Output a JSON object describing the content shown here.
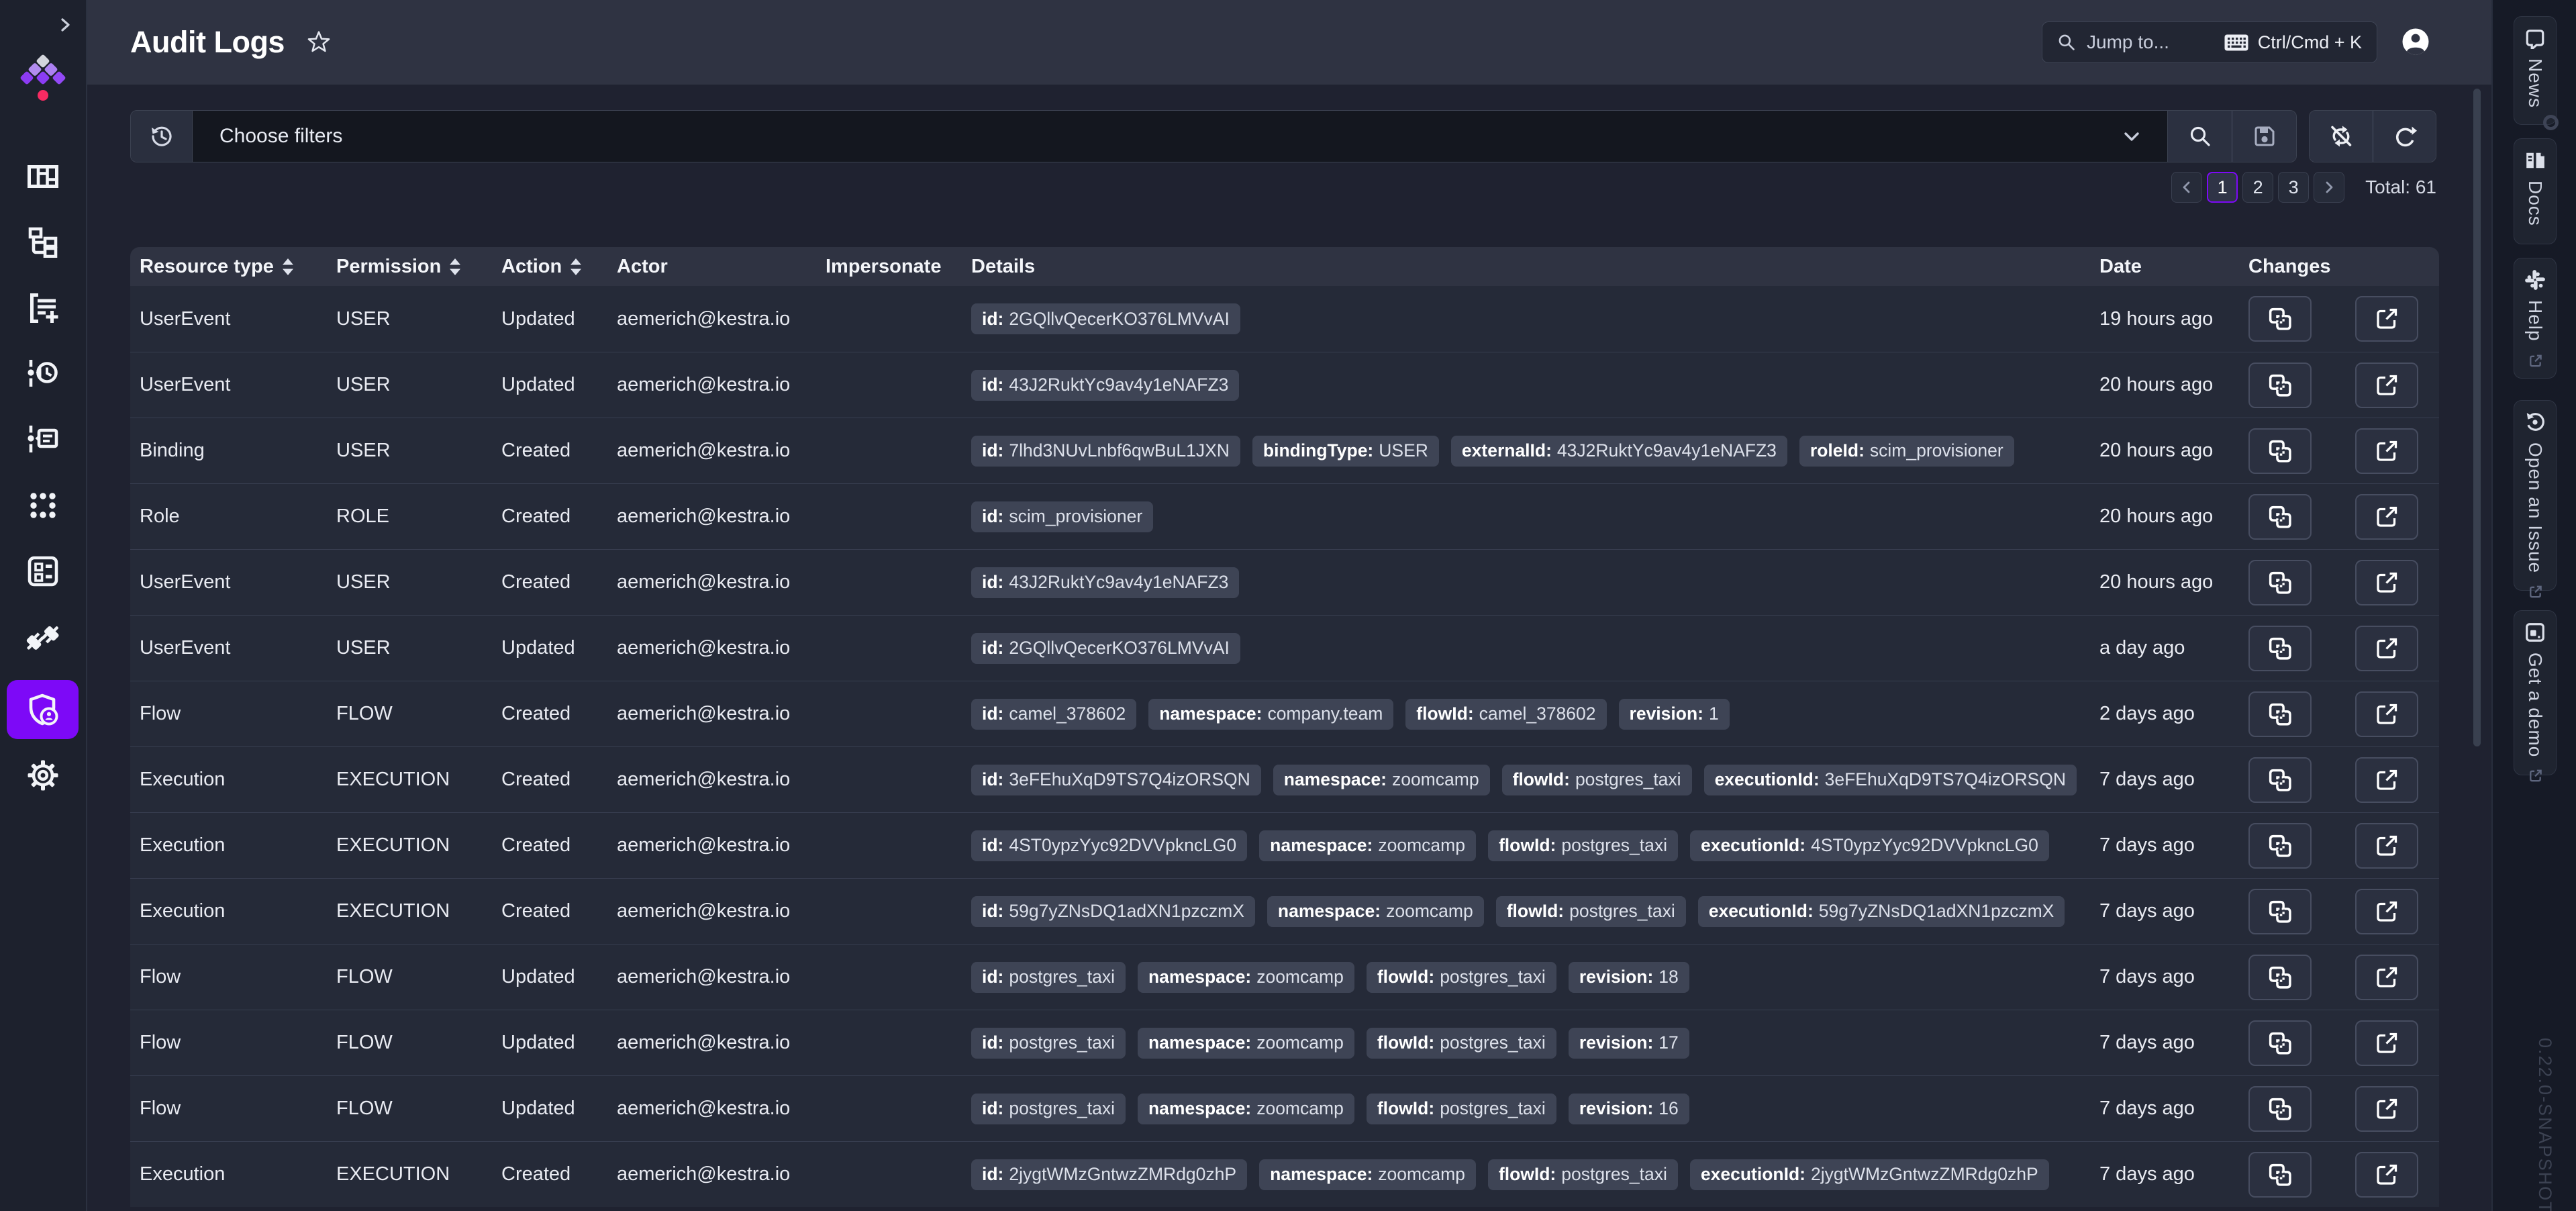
{
  "app": {
    "title": "Audit Logs"
  },
  "topbar": {
    "search_placeholder": "Jump to...",
    "shortcut": "Ctrl/Cmd + K"
  },
  "left_sidebar": {
    "items": [
      {
        "name": "dashboard",
        "icon": "dashboard-icon",
        "active": false
      },
      {
        "name": "flows",
        "icon": "flows-icon",
        "active": false
      },
      {
        "name": "executions",
        "icon": "executions-icon",
        "active": false
      },
      {
        "name": "logs",
        "icon": "logs-icon",
        "active": false
      },
      {
        "name": "namespaces",
        "icon": "namespaces-icon",
        "active": false
      },
      {
        "name": "apps",
        "icon": "apps-icon",
        "active": false
      },
      {
        "name": "blueprints",
        "icon": "blueprints-icon",
        "active": false
      },
      {
        "name": "plugins",
        "icon": "plugins-icon",
        "active": false
      },
      {
        "name": "iam-audit-logs",
        "icon": "shield-account-icon",
        "active": true
      },
      {
        "name": "settings",
        "icon": "gear-icon",
        "active": false
      }
    ],
    "active_color": "#7D09F7"
  },
  "filter": {
    "placeholder": "Choose filters"
  },
  "pagination": {
    "pages": [
      "1",
      "2",
      "3"
    ],
    "current": "1",
    "total_label": "Total: 61"
  },
  "table": {
    "columns": [
      {
        "label": "Resource type",
        "sortable": true
      },
      {
        "label": "Permission",
        "sortable": true
      },
      {
        "label": "Action",
        "sortable": true
      },
      {
        "label": "Actor",
        "sortable": false
      },
      {
        "label": "Impersonate",
        "sortable": false
      },
      {
        "label": "Details",
        "sortable": false
      },
      {
        "label": "Date",
        "sortable": false
      },
      {
        "label": "Changes",
        "sortable": false
      }
    ],
    "rows": [
      {
        "resource_type": "UserEvent",
        "permission": "USER",
        "action": "Updated",
        "actor": "aemerich@kestra.io",
        "impersonate": "",
        "details": [
          {
            "key": "id",
            "value": "2GQllvQecerKO376LMVvAI"
          }
        ],
        "date": "19 hours ago"
      },
      {
        "resource_type": "UserEvent",
        "permission": "USER",
        "action": "Updated",
        "actor": "aemerich@kestra.io",
        "impersonate": "",
        "details": [
          {
            "key": "id",
            "value": "43J2RuktYc9av4y1eNAFZ3"
          }
        ],
        "date": "20 hours ago"
      },
      {
        "resource_type": "Binding",
        "permission": "USER",
        "action": "Created",
        "actor": "aemerich@kestra.io",
        "impersonate": "",
        "details": [
          {
            "key": "id",
            "value": "7lhd3NUvLnbf6qwBuL1JXN"
          },
          {
            "key": "bindingType",
            "value": "USER"
          },
          {
            "key": "externalId",
            "value": "43J2RuktYc9av4y1eNAFZ3"
          },
          {
            "key": "roleId",
            "value": "scim_provisioner"
          }
        ],
        "date": "20 hours ago"
      },
      {
        "resource_type": "Role",
        "permission": "ROLE",
        "action": "Created",
        "actor": "aemerich@kestra.io",
        "impersonate": "",
        "details": [
          {
            "key": "id",
            "value": "scim_provisioner"
          }
        ],
        "date": "20 hours ago"
      },
      {
        "resource_type": "UserEvent",
        "permission": "USER",
        "action": "Created",
        "actor": "aemerich@kestra.io",
        "impersonate": "",
        "details": [
          {
            "key": "id",
            "value": "43J2RuktYc9av4y1eNAFZ3"
          }
        ],
        "date": "20 hours ago"
      },
      {
        "resource_type": "UserEvent",
        "permission": "USER",
        "action": "Updated",
        "actor": "aemerich@kestra.io",
        "impersonate": "",
        "details": [
          {
            "key": "id",
            "value": "2GQllvQecerKO376LMVvAI"
          }
        ],
        "date": "a day ago"
      },
      {
        "resource_type": "Flow",
        "permission": "FLOW",
        "action": "Created",
        "actor": "aemerich@kestra.io",
        "impersonate": "",
        "details": [
          {
            "key": "id",
            "value": "camel_378602"
          },
          {
            "key": "namespace",
            "value": "company.team"
          },
          {
            "key": "flowId",
            "value": "camel_378602"
          },
          {
            "key": "revision",
            "value": "1"
          }
        ],
        "date": "2 days ago"
      },
      {
        "resource_type": "Execution",
        "permission": "EXECUTION",
        "action": "Created",
        "actor": "aemerich@kestra.io",
        "impersonate": "",
        "details": [
          {
            "key": "id",
            "value": "3eFEhuXqD9TS7Q4izORSQN"
          },
          {
            "key": "namespace",
            "value": "zoomcamp"
          },
          {
            "key": "flowId",
            "value": "postgres_taxi"
          },
          {
            "key": "executionId",
            "value": "3eFEhuXqD9TS7Q4izORSQN"
          }
        ],
        "date": "7 days ago"
      },
      {
        "resource_type": "Execution",
        "permission": "EXECUTION",
        "action": "Created",
        "actor": "aemerich@kestra.io",
        "impersonate": "",
        "details": [
          {
            "key": "id",
            "value": "4ST0ypzYyc92DVVpkncLG0"
          },
          {
            "key": "namespace",
            "value": "zoomcamp"
          },
          {
            "key": "flowId",
            "value": "postgres_taxi"
          },
          {
            "key": "executionId",
            "value": "4ST0ypzYyc92DVVpkncLG0"
          }
        ],
        "date": "7 days ago"
      },
      {
        "resource_type": "Execution",
        "permission": "EXECUTION",
        "action": "Created",
        "actor": "aemerich@kestra.io",
        "impersonate": "",
        "details": [
          {
            "key": "id",
            "value": "59g7yZNsDQ1adXN1pzczmX"
          },
          {
            "key": "namespace",
            "value": "zoomcamp"
          },
          {
            "key": "flowId",
            "value": "postgres_taxi"
          },
          {
            "key": "executionId",
            "value": "59g7yZNsDQ1adXN1pzczmX"
          }
        ],
        "date": "7 days ago"
      },
      {
        "resource_type": "Flow",
        "permission": "FLOW",
        "action": "Updated",
        "actor": "aemerich@kestra.io",
        "impersonate": "",
        "details": [
          {
            "key": "id",
            "value": "postgres_taxi"
          },
          {
            "key": "namespace",
            "value": "zoomcamp"
          },
          {
            "key": "flowId",
            "value": "postgres_taxi"
          },
          {
            "key": "revision",
            "value": "18"
          }
        ],
        "date": "7 days ago"
      },
      {
        "resource_type": "Flow",
        "permission": "FLOW",
        "action": "Updated",
        "actor": "aemerich@kestra.io",
        "impersonate": "",
        "details": [
          {
            "key": "id",
            "value": "postgres_taxi"
          },
          {
            "key": "namespace",
            "value": "zoomcamp"
          },
          {
            "key": "flowId",
            "value": "postgres_taxi"
          },
          {
            "key": "revision",
            "value": "17"
          }
        ],
        "date": "7 days ago"
      },
      {
        "resource_type": "Flow",
        "permission": "FLOW",
        "action": "Updated",
        "actor": "aemerich@kestra.io",
        "impersonate": "",
        "details": [
          {
            "key": "id",
            "value": "postgres_taxi"
          },
          {
            "key": "namespace",
            "value": "zoomcamp"
          },
          {
            "key": "flowId",
            "value": "postgres_taxi"
          },
          {
            "key": "revision",
            "value": "16"
          }
        ],
        "date": "7 days ago"
      },
      {
        "resource_type": "Execution",
        "permission": "EXECUTION",
        "action": "Created",
        "actor": "aemerich@kestra.io",
        "impersonate": "",
        "details": [
          {
            "key": "id",
            "value": "2jygtWMzGntwzZMRdg0zhP"
          },
          {
            "key": "namespace",
            "value": "zoomcamp"
          },
          {
            "key": "flowId",
            "value": "postgres_taxi"
          },
          {
            "key": "executionId",
            "value": "2jygtWMzGntwzZMRdg0zhP"
          }
        ],
        "date": "7 days ago"
      }
    ]
  },
  "right_sidebar": {
    "tabs": [
      {
        "label": "News",
        "icon": "news-icon",
        "external": false
      },
      {
        "label": "Docs",
        "icon": "docs-icon",
        "external": false
      },
      {
        "label": "Help",
        "icon": "slack-icon",
        "external": true
      },
      {
        "label": "Open an Issue",
        "icon": "issue-icon",
        "external": true
      },
      {
        "label": "Get a demo",
        "icon": "demo-icon",
        "external": true
      }
    ],
    "version": "0.22.0-SNAPSHOT"
  }
}
